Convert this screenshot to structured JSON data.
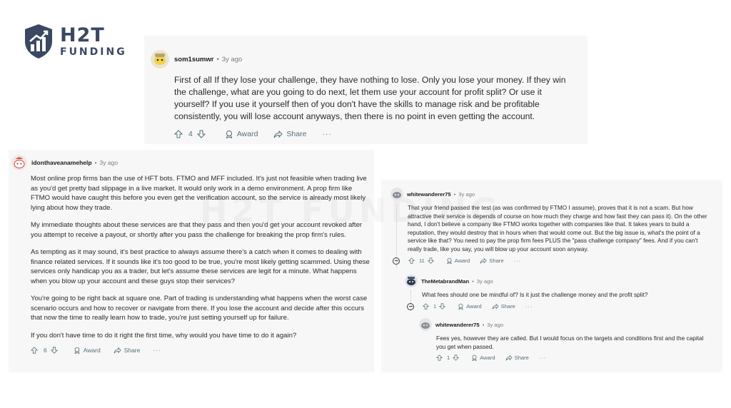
{
  "brand": {
    "name": "H2T",
    "tagline": "FUNDING",
    "watermark": "H2T FUNDING"
  },
  "colors": {
    "brand": "#3b4863",
    "card_bg": "#f7f7f8",
    "meta_text": "#7c7c7c",
    "action_text": "#576f76"
  },
  "comments": [
    {
      "user": "som1sumwr",
      "age": "3y ago",
      "avatar_icon": "snoo-avatar-icon",
      "paragraphs": [
        "First of all If they lose your challenge, they have nothing to lose. Only you lose your money. If they win the challenge, what are you going to do next, let them use your account for profit split? Or use it yourself? If you use it yourself then of you don't have the skills to manage risk and be profitable consistently, you will lose account anyways, then there is no point in even getting the account."
      ],
      "votes": "4",
      "award_label": "Award",
      "share_label": "Share",
      "more_label": "···"
    },
    {
      "user": "idonthaveanamehelp",
      "age": "3y ago",
      "avatar_icon": "snoo-avatar-icon",
      "paragraphs": [
        "Most online prop firms ban the use of HFT bots. FTMO and MFF included. It's just not feasible when trading live as you'd get pretty bad slippage in a live market. It would only work in a demo environment. A prop firm like FTMO would have caught this before you even get the verification account, so the service is already most likely lying about how they trade.",
        "My immediate thoughts about these services are that they pass and then you'd get your account revoked after you attempt to receive a payout, or shortly after you pass the challenge for breaking the prop firm's rules.",
        "As tempting as it may sound, it's best practice to always assume there's a catch when it comes to dealing with finance related services. If it sounds like it's too good to be true, you're most likely getting scammed. Using these services only handicap you as a trader, but let's assume these services are legit for a minute. What happens when you blow up your account and these guys stop their services?",
        "You're going to be right back at square one. Part of trading is understanding what happens when the worst case scenario occurs and how to recover or navigate from there. If you lose the account and decide after this occurs that now the time to really learn how to trade, you're just setting yourself up for failure.",
        "If you don't have time to do it right the first time, why would you have time to do it again?"
      ],
      "votes": "6",
      "award_label": "Award",
      "share_label": "Share",
      "more_label": "···"
    },
    {
      "user": "whitewanderer75",
      "age": "3y ago",
      "avatar_icon": "snoo-avatar-icon",
      "paragraphs": [
        "That your friend passed the test (as was confirmed by FTMO I assume), proves that it is not a scam. But how attractive their service is depends of course on how much they charge and how fast they can pass it). On the other hand, I don't believe a company like FTMO works together with companies like that. It takes years to build a reputation, they would destroy that in hours when that would come out. But the big issue is, what's the point of a service like that? You need to pay the prop firm fees PLUS the \"pass challenge company\" fees. And if you can't really trade, like you say, you will blow up your account soon anyway."
      ],
      "votes": "11",
      "award_label": "Award",
      "share_label": "Share",
      "more_label": "···"
    },
    {
      "user": "TheMetabrandMan",
      "age": "3y ago",
      "avatar_icon": "snoo-avatar-icon",
      "paragraphs": [
        "What fees should one be mindful of? Is it just the challenge money and the profit split?"
      ],
      "votes": "1",
      "award_label": "Award",
      "share_label": "Share",
      "more_label": "···"
    },
    {
      "user": "whitewanderer75",
      "age": "3y ago",
      "avatar_icon": "snoo-avatar-icon",
      "paragraphs": [
        "Fees yes, however they are called. But I would focus on the targets and conditions first and the capital you get when passed."
      ],
      "votes": "1",
      "award_label": "Award",
      "share_label": "Share",
      "more_label": "···"
    }
  ]
}
